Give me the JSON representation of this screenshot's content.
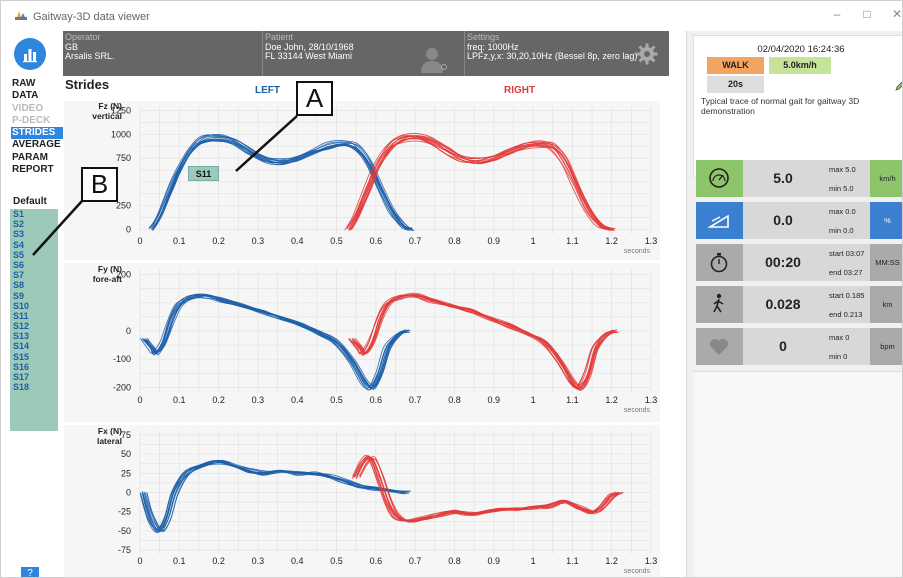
{
  "app": {
    "title": "Gaitway-3D data viewer"
  },
  "window_controls": {
    "minimize": "–",
    "maximize": "□",
    "close": "✕"
  },
  "header": {
    "operator": {
      "label": "Operator",
      "line1": "GB",
      "line2": "Arsalis SRL."
    },
    "patient": {
      "label": "Patient",
      "line1": "Doe John, 28/10/1968",
      "line2": "FL 33144 West Miami"
    },
    "settings": {
      "label": "Settings",
      "line1": "freq: 1000Hz",
      "line2": "LPFz,y,x: 30,20,10Hz (Bessel 8p, zero lag)"
    }
  },
  "nav": {
    "items": [
      {
        "label": "RAW",
        "state": "normal"
      },
      {
        "label": "DATA",
        "state": "normal"
      },
      {
        "label": "VIDEO",
        "state": "disabled"
      },
      {
        "label": "P-DECK",
        "state": "disabled"
      },
      {
        "label": "STRIDES",
        "state": "active"
      },
      {
        "label": "AVERAGE",
        "state": "normal"
      },
      {
        "label": "PARAM",
        "state": "normal"
      },
      {
        "label": "REPORT",
        "state": "normal"
      }
    ],
    "default_label": "Default",
    "strides": [
      "S1",
      "S2",
      "S3",
      "S4",
      "S5",
      "S6",
      "S7",
      "S8",
      "S9",
      "S10",
      "S11",
      "S12",
      "S13",
      "S14",
      "S15",
      "S16",
      "S17",
      "S18"
    ],
    "help": "?"
  },
  "main": {
    "title": "Strides",
    "left_label": "LEFT",
    "right_label": "RIGHT",
    "tooltip": "S11",
    "annotations": {
      "a": "A",
      "b": "B"
    }
  },
  "chart_data": [
    {
      "type": "line",
      "ylabel": "Fz (N)",
      "ylabel2": "vertical",
      "xunit": "seconds",
      "xticks": [
        0,
        0.1,
        0.2,
        0.3,
        0.4,
        0.5,
        0.6,
        0.7,
        0.8,
        0.9,
        1,
        1.1,
        1.2,
        1.3
      ],
      "yticks": [
        0,
        250,
        500,
        750,
        1000,
        1250
      ],
      "ytick_labels": [
        "0",
        "250",
        "",
        "750",
        "1000",
        "1250"
      ],
      "xlim": [
        0,
        1.3
      ],
      "ylim": [
        -50,
        1300
      ],
      "series": [
        {
          "color": "#1c5fa8",
          "x": [
            0.03,
            0.05,
            0.08,
            0.1,
            0.13,
            0.16,
            0.2,
            0.24,
            0.28,
            0.32,
            0.36,
            0.4,
            0.44,
            0.48,
            0.52,
            0.55,
            0.58,
            0.61,
            0.64,
            0.67,
            0.69
          ],
          "y": [
            0,
            150,
            450,
            650,
            850,
            950,
            975,
            930,
            830,
            740,
            720,
            760,
            830,
            890,
            910,
            870,
            720,
            450,
            200,
            40,
            0
          ]
        },
        {
          "color": "#e23b3b",
          "x": [
            0.53,
            0.55,
            0.58,
            0.6,
            0.63,
            0.66,
            0.7,
            0.74,
            0.78,
            0.82,
            0.86,
            0.9,
            0.94,
            0.98,
            1.02,
            1.05,
            1.08,
            1.11,
            1.14,
            1.17,
            1.2
          ],
          "y": [
            0,
            150,
            450,
            650,
            850,
            950,
            975,
            930,
            830,
            740,
            720,
            760,
            830,
            890,
            910,
            870,
            720,
            450,
            200,
            40,
            0
          ]
        }
      ]
    },
    {
      "type": "line",
      "ylabel": "Fy (N)",
      "ylabel2": "fore-aft",
      "xunit": "seconds",
      "xticks": [
        0,
        0.1,
        0.2,
        0.3,
        0.4,
        0.5,
        0.6,
        0.7,
        0.8,
        0.9,
        1,
        1.1,
        1.2,
        1.3
      ],
      "yticks": [
        -200,
        -100,
        0,
        100,
        200
      ],
      "ytick_labels": [
        "-200",
        "-100",
        "0",
        "",
        "200"
      ],
      "xlim": [
        0,
        1.3
      ],
      "ylim": [
        -220,
        220
      ],
      "series": [
        {
          "color": "#1c5fa8",
          "x": [
            0.01,
            0.03,
            0.04,
            0.06,
            0.08,
            0.1,
            0.13,
            0.17,
            0.21,
            0.26,
            0.31,
            0.36,
            0.41,
            0.46,
            0.5,
            0.54,
            0.57,
            0.59,
            0.61,
            0.63,
            0.66,
            0.68
          ],
          "y": [
            -30,
            -60,
            -80,
            -40,
            40,
            95,
            120,
            125,
            110,
            90,
            70,
            45,
            20,
            -10,
            -40,
            -110,
            -180,
            -200,
            -150,
            -60,
            -10,
            0
          ]
        },
        {
          "color": "#e23b3b",
          "x": [
            0.54,
            0.56,
            0.57,
            0.59,
            0.61,
            0.63,
            0.66,
            0.7,
            0.74,
            0.79,
            0.84,
            0.89,
            0.94,
            0.99,
            1.03,
            1.07,
            1.1,
            1.12,
            1.14,
            1.16,
            1.19,
            1.21
          ],
          "y": [
            -30,
            -60,
            -80,
            -40,
            40,
            95,
            120,
            125,
            110,
            90,
            70,
            45,
            20,
            -10,
            -40,
            -110,
            -180,
            -200,
            -150,
            -60,
            -10,
            0
          ]
        }
      ]
    },
    {
      "type": "line",
      "ylabel": "Fx (N)",
      "ylabel2": "lateral",
      "xunit": "seconds",
      "xticks": [
        0,
        0.1,
        0.2,
        0.3,
        0.4,
        0.5,
        0.6,
        0.7,
        0.8,
        0.9,
        1,
        1.1,
        1.2,
        1.3
      ],
      "yticks": [
        -75,
        -50,
        -25,
        0,
        25,
        50,
        75
      ],
      "ytick_labels": [
        "-75",
        "-50",
        "-25",
        "0",
        "25",
        "50",
        "75"
      ],
      "xlim": [
        0,
        1.3
      ],
      "ylim": [
        -80,
        80
      ],
      "series": [
        {
          "color": "#1c5fa8",
          "x": [
            0.01,
            0.02,
            0.03,
            0.05,
            0.07,
            0.09,
            0.12,
            0.16,
            0.2,
            0.24,
            0.28,
            0.32,
            0.36,
            0.4,
            0.44,
            0.48,
            0.52,
            0.56,
            0.6,
            0.64,
            0.68
          ],
          "y": [
            0,
            -20,
            -35,
            -50,
            -35,
            0,
            25,
            35,
            40,
            35,
            28,
            25,
            28,
            25,
            25,
            22,
            15,
            8,
            5,
            2,
            0
          ]
        },
        {
          "color": "#e23b3b",
          "x": [
            0.55,
            0.57,
            0.59,
            0.61,
            0.63,
            0.65,
            0.68,
            0.72,
            0.76,
            0.8,
            0.84,
            0.88,
            0.92,
            0.96,
            1,
            1.04,
            1.08,
            1.12,
            1.16,
            1.2,
            1.22
          ],
          "y": [
            20,
            40,
            45,
            20,
            -10,
            -30,
            -38,
            -35,
            -30,
            -25,
            -28,
            -25,
            -22,
            -22,
            -20,
            -18,
            -12,
            -20,
            -25,
            -5,
            0
          ]
        }
      ]
    }
  ],
  "right_panel": {
    "datetime": "02/04/2020  16:24:36",
    "mode": "WALK",
    "speed": "5.0km/h",
    "duration": "20s",
    "description": "Typical trace of normal gait for gaitway 3D demonstration",
    "metrics": [
      {
        "icon": "speedometer-icon",
        "value": "5.0",
        "lim1_label": "max",
        "lim1": "5.0",
        "lim2_label": "min",
        "lim2": "5.0",
        "unit": "km/h",
        "color": "#8cc56a"
      },
      {
        "icon": "incline-icon",
        "value": "0.0",
        "lim1_label": "max",
        "lim1": "0.0",
        "lim2_label": "min",
        "lim2": "0.0",
        "unit": "%",
        "color": "#3b7fd0"
      },
      {
        "icon": "stopwatch-icon",
        "value": "00:20",
        "lim1_label": "start",
        "lim1": "03:07",
        "lim2_label": "end",
        "lim2": "03:27",
        "unit": "MM:SS",
        "color": "#aaaaaa"
      },
      {
        "icon": "walker-icon",
        "value": "0.028",
        "lim1_label": "start",
        "lim1": "0.185",
        "lim2_label": "end",
        "lim2": "0.213",
        "unit": "km",
        "color": "#aaaaaa"
      },
      {
        "icon": "heart-icon",
        "value": "0",
        "lim1_label": "max",
        "lim1": "0",
        "lim2_label": "min",
        "lim2": "0",
        "unit": "bpm",
        "color": "#aaaaaa"
      }
    ]
  }
}
